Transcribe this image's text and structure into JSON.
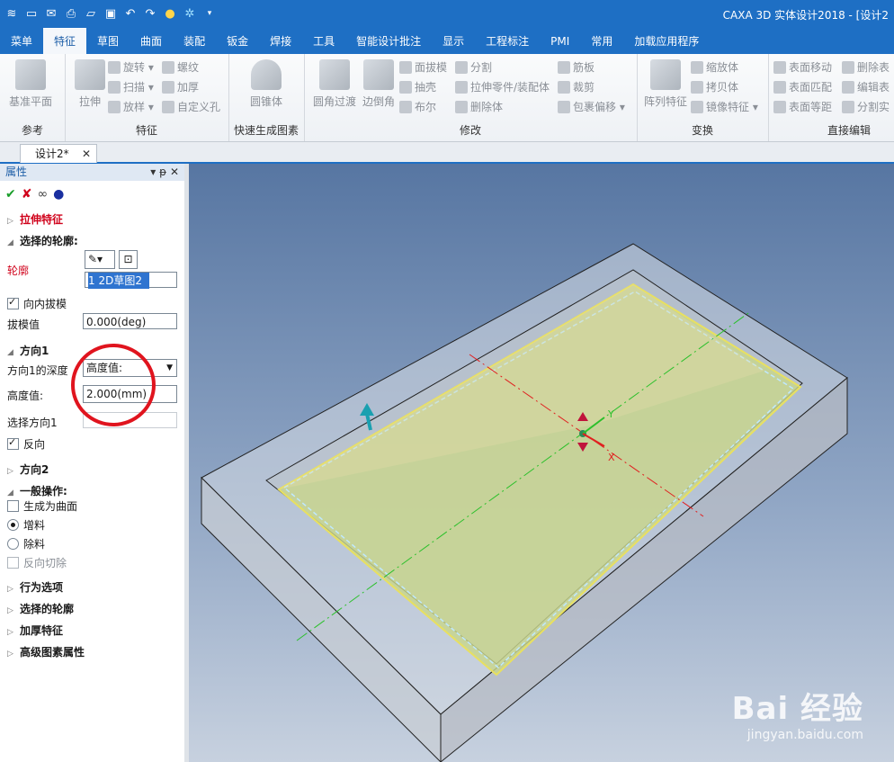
{
  "titlebar": {
    "title": "CAXA 3D 实体设计2018 - [设计2",
    "qat_icons": [
      "app-icon",
      "new-icon",
      "close-doc-icon",
      "print-icon",
      "open-icon",
      "save-icon",
      "undo-icon",
      "redo-icon",
      "bulb-icon",
      "sparkle-icon",
      "dropdown-icon"
    ]
  },
  "menu": {
    "tabs": [
      "菜单",
      "特征",
      "草图",
      "曲面",
      "装配",
      "钣金",
      "焊接",
      "工具",
      "智能设计批注",
      "显示",
      "工程标注",
      "PMI",
      "常用",
      "加载应用程序"
    ],
    "active": "特征"
  },
  "ribbon": {
    "groups": {
      "reference": {
        "label": "参考",
        "buttons": [
          "基准平面"
        ]
      },
      "feature": {
        "label": "特征",
        "big": "拉伸",
        "small": [
          "旋转",
          "扫描",
          "放样",
          "螺纹",
          "加厚",
          "自定义孔"
        ]
      },
      "quick": {
        "label": "快速生成图素",
        "big": "圆锥体"
      },
      "modify": {
        "label": "修改",
        "big": [
          "圆角过渡",
          "边倒角"
        ],
        "small": [
          "面拔模",
          "抽壳",
          "布尔",
          "分割",
          "拉伸零件/装配体",
          "删除体",
          "筋板",
          "裁剪",
          "包裹偏移"
        ]
      },
      "transform": {
        "label": "变换",
        "big": "阵列特征",
        "small": [
          "缩放体",
          "拷贝体",
          "镜像特征"
        ]
      },
      "direct": {
        "label": "直接编辑",
        "small": [
          "表面移动",
          "表面匹配",
          "表面等距",
          "删除表",
          "编辑表",
          "分割实"
        ]
      }
    }
  },
  "doc_tab": {
    "label": "设计2*",
    "close": "✕"
  },
  "panel": {
    "title": "属性",
    "controls": "▾ ᵽ ✕",
    "section_extrude": "拉伸特征",
    "section_profile": "选择的轮廓:",
    "profile_label": "轮廓",
    "profile_value": "1    2D草图2",
    "inward_draft": "向内拔模",
    "draft_label": "拔模值",
    "draft_value": "0.000(deg)",
    "section_dir1": "方向1",
    "dir1_depth_label": "方向1的深度",
    "dir1_depth_value": "高度值:",
    "height_label": "高度值:",
    "height_value": "2.000(mm)",
    "select_dir_label": "选择方向1",
    "reverse": "反向",
    "section_dir2": "方向2",
    "section_general": "一般操作:",
    "opt_surface": "生成为曲面",
    "opt_add": "增料",
    "opt_remove": "除料",
    "opt_reverse_cut": "反向切除",
    "collapsed": [
      "行为选项",
      "选择的轮廓",
      "加厚特征",
      "高级图素属性"
    ]
  },
  "viewport": {
    "axis_y": "Y",
    "axis_x": "X"
  },
  "watermark": {
    "brand": "Bai 经验",
    "url": "jingyan.baidu.com"
  }
}
